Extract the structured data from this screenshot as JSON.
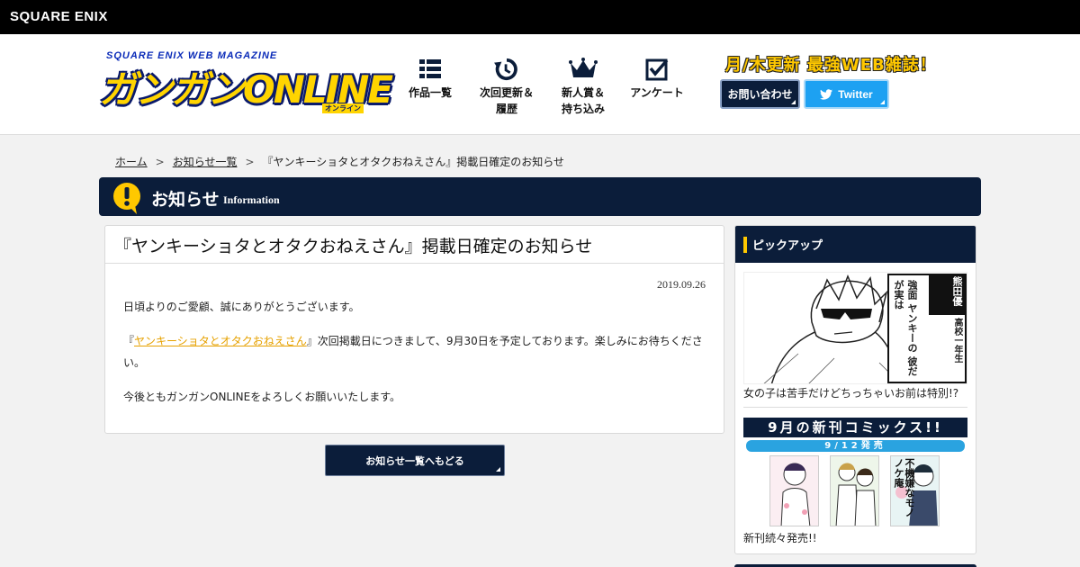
{
  "topbar": {
    "corp_logo": "SQUARE ENIX"
  },
  "header": {
    "logo_sub": "SQUARE ENIX WEB MAGAZINE",
    "logo_main": "ガンガンONLINE",
    "logo_kana": "オンライン",
    "nav": [
      {
        "label": "作品一覧",
        "icon": "grid-list-icon"
      },
      {
        "label": "次回更新＆\n履歴",
        "icon": "refresh-clock-icon"
      },
      {
        "label": "新人賞＆\n持ち込み",
        "icon": "crown-icon"
      },
      {
        "label": "アンケート",
        "icon": "checkbox-icon"
      }
    ],
    "tagline": "月/木更新 最強WEB雑誌！",
    "contact_label": "お問い合わせ",
    "twitter_label": "Twitter"
  },
  "breadcrumb": {
    "home": "ホーム",
    "sep1": ">",
    "list": "お知らせ一覧",
    "sep2": ">",
    "current": "『ヤンキーショタとオタクおねえさん』掲載日確定のお知らせ"
  },
  "section": {
    "title": "お知らせ",
    "subtitle": "Information"
  },
  "article": {
    "title": "『ヤンキーショタとオタクおねえさん』掲載日確定のお知らせ",
    "date": "2019.09.26",
    "p1": "日頃よりのご愛顧、誠にありがとうございます。",
    "p2_open": "『",
    "p2_link": "ヤンキーショタとオタクおねえさん",
    "p2_rest": "』次回掲載日につきまして、9月30日を予定しております。楽しみにお待ちください。",
    "p3": "今後ともガンガンONLINEをよろしくお願いいたします。"
  },
  "back_button": "お知らせ一覧へもどる",
  "pickup": {
    "title": "ピックアップ",
    "item1": {
      "caption": "女の子は苦手だけどちっちゃいお前は特別!?",
      "balloon_lines": [
        "熊田優",
        "高校一年生",
        "強面",
        "ヤンキーの",
        "彼だが実は"
      ]
    },
    "item2": {
      "caption": "新刊続々発売!!",
      "banner_title": "9月の新刊コミックス!!",
      "banner_date": "9/12発売",
      "cover3_title": "不機嫌なモノノケ庵"
    }
  },
  "colors": {
    "navy": "#0b1d3a",
    "accent_yellow": "#ffc800",
    "twitter_blue": "#1da1f2",
    "link_orange": "#e6a100"
  }
}
